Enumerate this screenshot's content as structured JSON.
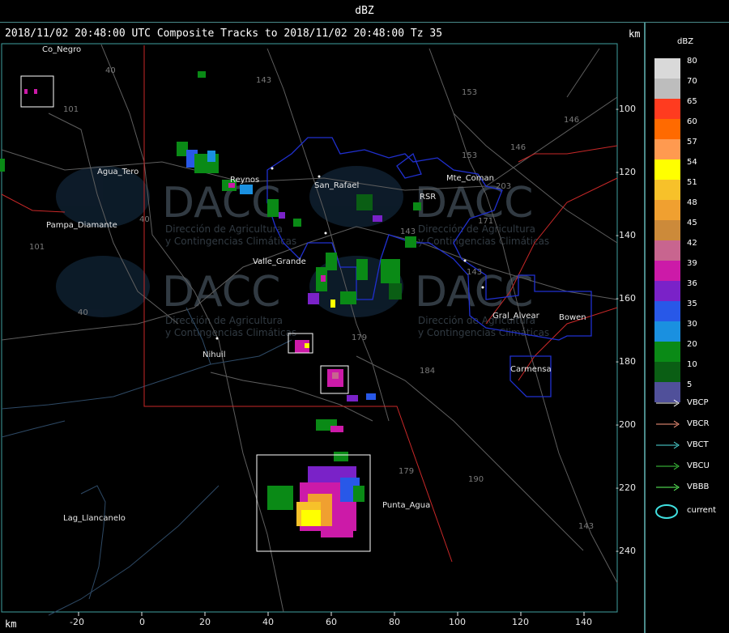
{
  "window": {
    "title": "dBZ"
  },
  "header": {
    "text": "2018/11/02 20:48:00 UTC Composite Tracks to 2018/11/02 20:48:00 Tz 35",
    "unit_top": "km",
    "unit_bottom": "km"
  },
  "x_ticks": [
    "-20",
    "0",
    "20",
    "40",
    "60",
    "80",
    "100",
    "120",
    "140"
  ],
  "y_ticks": [
    "-100",
    "-120",
    "-140",
    "-160",
    "-180",
    "-200",
    "-220",
    "-240"
  ],
  "places": [
    "Co_Negro",
    "Agua_Tero",
    "Reynos",
    "San_Rafael",
    "RSR",
    "Mte_Coman",
    "Pampa_Diamante",
    "Valle_Grande",
    "Gral_Alvear",
    "Bowen",
    "Nihuil",
    "Carmensa",
    "Punta_Agua",
    "Lag_Llancanelo"
  ],
  "road_numbers": [
    "40",
    "101",
    "143",
    "153",
    "146",
    "146",
    "153",
    "203",
    "171",
    "143",
    "40",
    "101",
    "40",
    "143",
    "179",
    "184",
    "179",
    "190",
    "143"
  ],
  "watermark": {
    "brand": "DACC",
    "line1": "Dirección de Agricultura",
    "line2": "y Contingencias Climáticas"
  },
  "legend": {
    "title": "dBZ",
    "levels": [
      {
        "label": "80",
        "color": "#d9d9d9"
      },
      {
        "label": "70",
        "color": "#bdbdbd"
      },
      {
        "label": "65",
        "color": "#ff3b1f"
      },
      {
        "label": "60",
        "color": "#ff6a00"
      },
      {
        "label": "57",
        "color": "#ff9a50"
      },
      {
        "label": "54",
        "color": "#ffff00"
      },
      {
        "label": "51",
        "color": "#f7c12a"
      },
      {
        "label": "48",
        "color": "#f0a030"
      },
      {
        "label": "45",
        "color": "#cc8a3a"
      },
      {
        "label": "42",
        "color": "#c8658f"
      },
      {
        "label": "39",
        "color": "#cc1aa8"
      },
      {
        "label": "36",
        "color": "#7a22c8"
      },
      {
        "label": "35",
        "color": "#2858e8"
      },
      {
        "label": "30",
        "color": "#1a90e0"
      },
      {
        "label": "20",
        "color": "#0a8a16"
      },
      {
        "label": "10",
        "color": "#0a5e14"
      },
      {
        "label": "5",
        "color": "#50509a"
      }
    ],
    "tracks": [
      {
        "label": "VBCP",
        "color": "#ffffff"
      },
      {
        "label": "VBCR",
        "color": "#ff9a80"
      },
      {
        "label": "VBCT",
        "color": "#50e0e0"
      },
      {
        "label": "VBCU",
        "color": "#40d040"
      },
      {
        "label": "VBBB",
        "color": "#60ff60"
      },
      {
        "label": "current",
        "color": "#40e0e0"
      }
    ]
  }
}
